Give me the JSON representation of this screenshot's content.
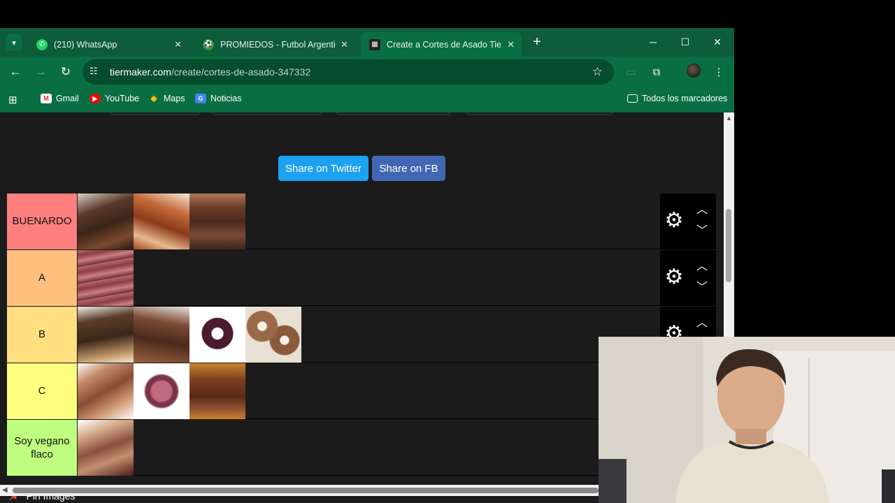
{
  "tabs": [
    {
      "title": "(210) WhatsApp",
      "icon": "whatsapp-icon",
      "color": "#25d366"
    },
    {
      "title": "PROMIEDOS - Futbol Argentino",
      "icon": "promiedos-icon",
      "color": "#2e9c3a"
    },
    {
      "title": "Create a Cortes de Asado Tier List",
      "icon": "tiermaker-icon",
      "color": "#222222",
      "active": true
    }
  ],
  "address": {
    "domain": "tiermaker.com",
    "path": "/create/cortes-de-asado-347332"
  },
  "bookmarks": [
    {
      "label": "Gmail",
      "icon": "gmail-icon"
    },
    {
      "label": "YouTube",
      "icon": "youtube-icon"
    },
    {
      "label": "Maps",
      "icon": "maps-icon"
    },
    {
      "label": "Noticias",
      "icon": "news-icon"
    }
  ],
  "all_bookmarks_label": "Todos los marcadores",
  "share": {
    "twitter": "Share on Twitter",
    "facebook": "Share on FB"
  },
  "tiers": [
    {
      "label": "BUENARDO",
      "color": "#ff7f7f",
      "item_count": 3
    },
    {
      "label": "A",
      "color": "#ffbf7f",
      "item_count": 1
    },
    {
      "label": "B",
      "color": "#ffdf7f",
      "item_count": 4
    },
    {
      "label": "C",
      "color": "#ffff7f",
      "item_count": 3
    },
    {
      "label": "Soy vegano flaco",
      "color": "#bfff7f",
      "item_count": 1
    }
  ],
  "pin_images_label": "Pin Images",
  "theme": {
    "chrome_green": "#0a6e43",
    "page_bg": "#1b1b1b"
  }
}
